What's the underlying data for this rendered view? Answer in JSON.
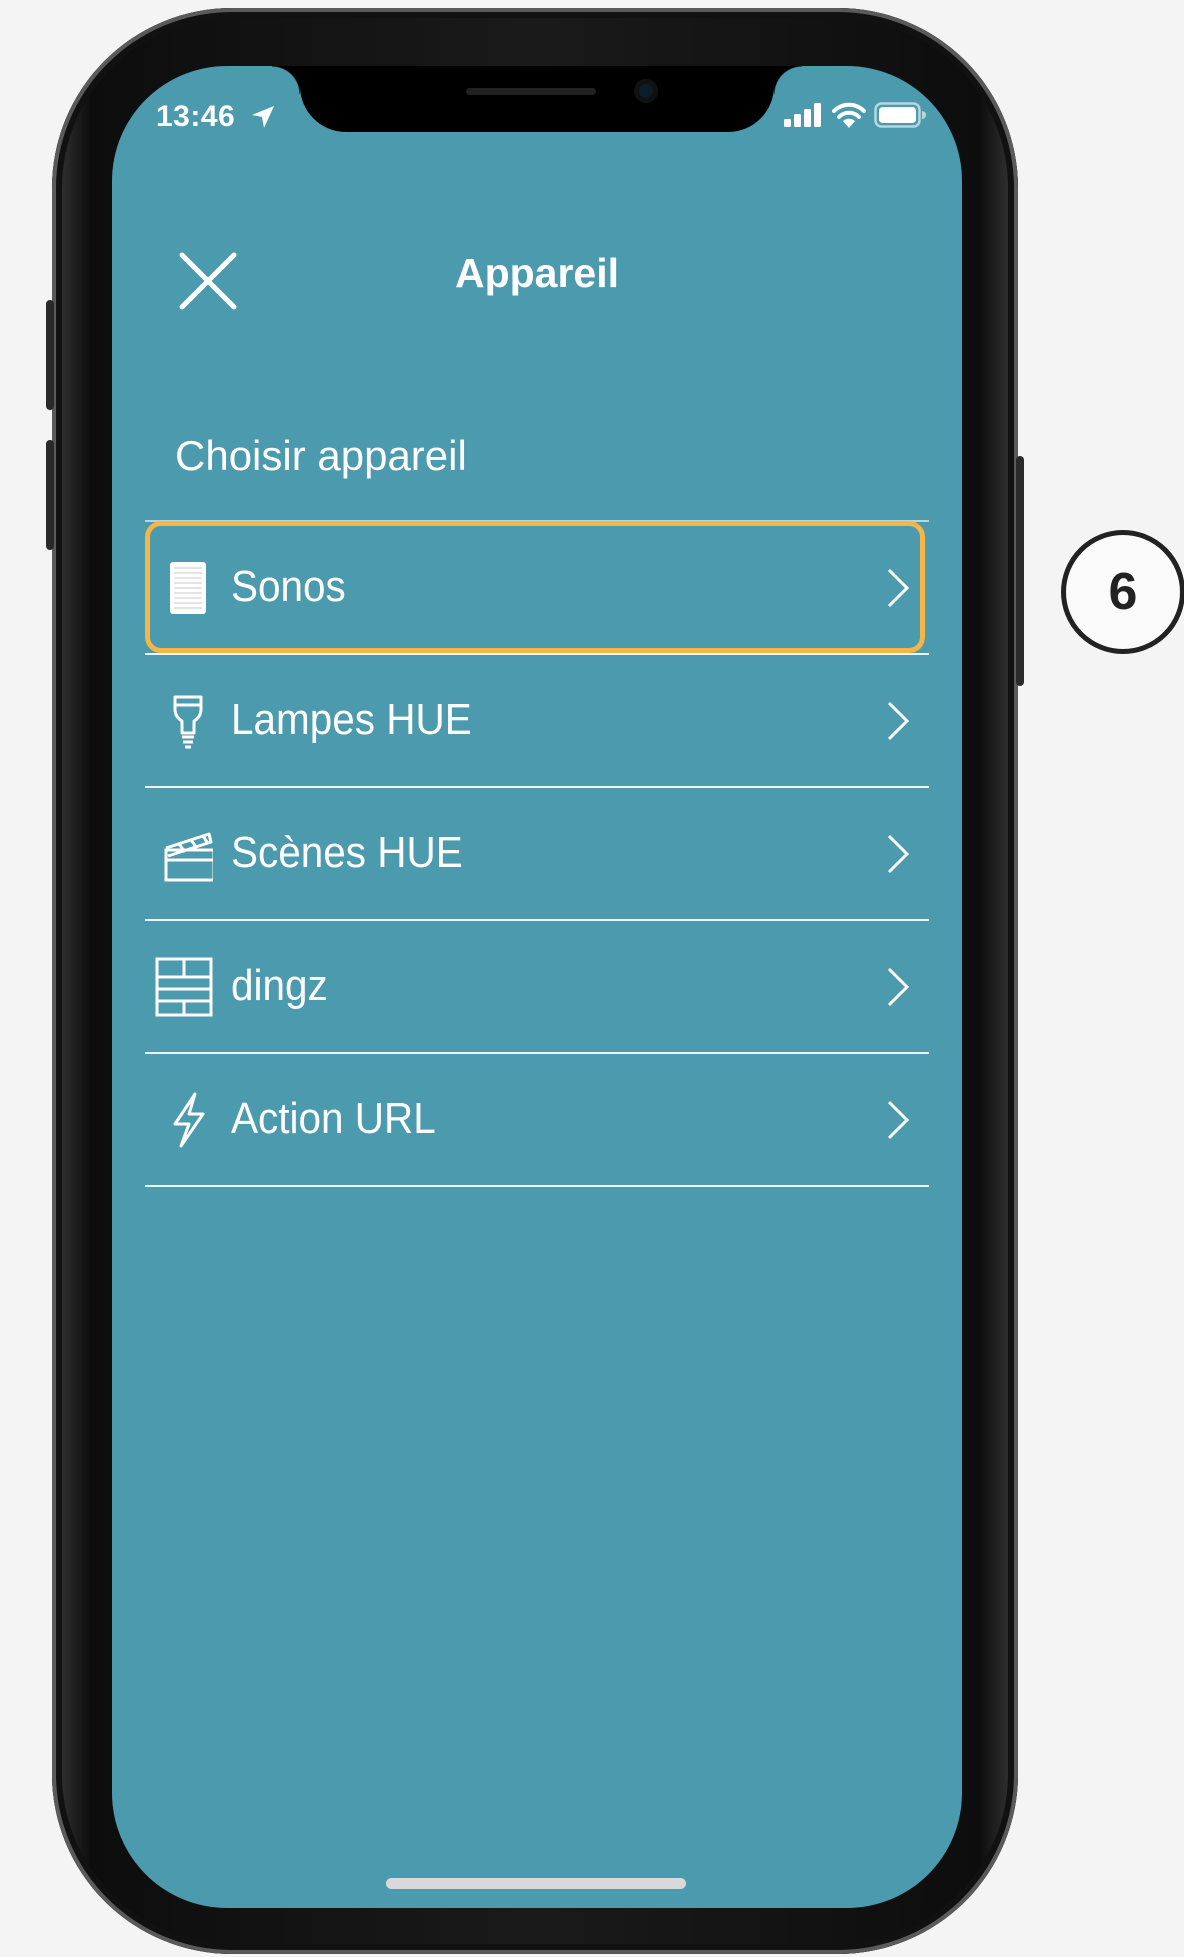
{
  "status_bar": {
    "time": "13:46",
    "icons": [
      "location-arrow-icon",
      "signal-icon",
      "wifi-icon",
      "battery-icon"
    ]
  },
  "header": {
    "title": "Appareil",
    "close_icon": "close-icon"
  },
  "section": {
    "label": "Choisir appareil"
  },
  "devices": [
    {
      "label": "Sonos",
      "icon": "sonos-speaker-icon",
      "highlighted": true
    },
    {
      "label": "Lampes HUE",
      "icon": "light-bulb-icon",
      "highlighted": false
    },
    {
      "label": "Scènes HUE",
      "icon": "clapperboard-icon",
      "highlighted": false
    },
    {
      "label": "dingz",
      "icon": "dingz-switch-icon",
      "highlighted": false
    },
    {
      "label": "Action URL",
      "icon": "lightning-icon",
      "highlighted": false
    }
  ],
  "annotation": {
    "step_number": "6"
  },
  "colors": {
    "screen_background": "#4b9aae",
    "highlight": "#f5b547",
    "text": "#ffffff"
  }
}
